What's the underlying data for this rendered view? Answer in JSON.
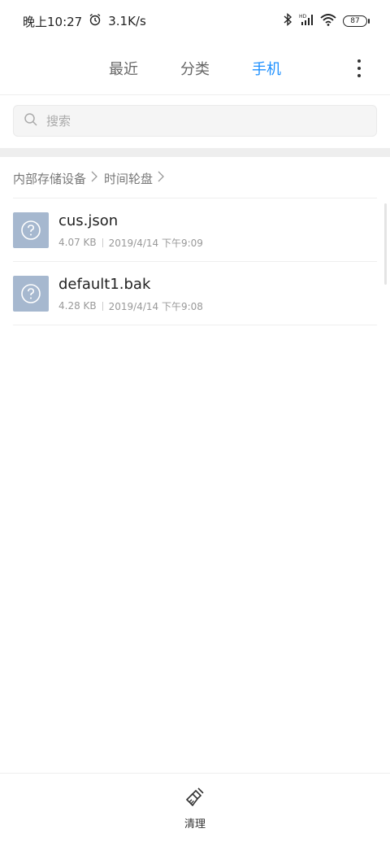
{
  "status_bar": {
    "time": "晚上10:27",
    "speed": "3.1K/s",
    "battery": "87",
    "icons": [
      "alarm-icon",
      "bluetooth-icon",
      "signal-icon",
      "wifi-icon",
      "battery-icon"
    ]
  },
  "tabs": [
    {
      "label": "最近",
      "active": false
    },
    {
      "label": "分类",
      "active": false
    },
    {
      "label": "手机",
      "active": true
    }
  ],
  "accent_color": "#1e90ff",
  "search": {
    "placeholder": "搜索"
  },
  "breadcrumb": [
    "内部存储设备",
    "时间轮盘"
  ],
  "files": [
    {
      "name": "cus.json",
      "size": "4.07 KB",
      "date": "2019/4/14 下午9:09"
    },
    {
      "name": "default1.bak",
      "size": "4.28 KB",
      "date": "2019/4/14 下午9:08"
    }
  ],
  "bottom": {
    "clean_label": "清理"
  }
}
